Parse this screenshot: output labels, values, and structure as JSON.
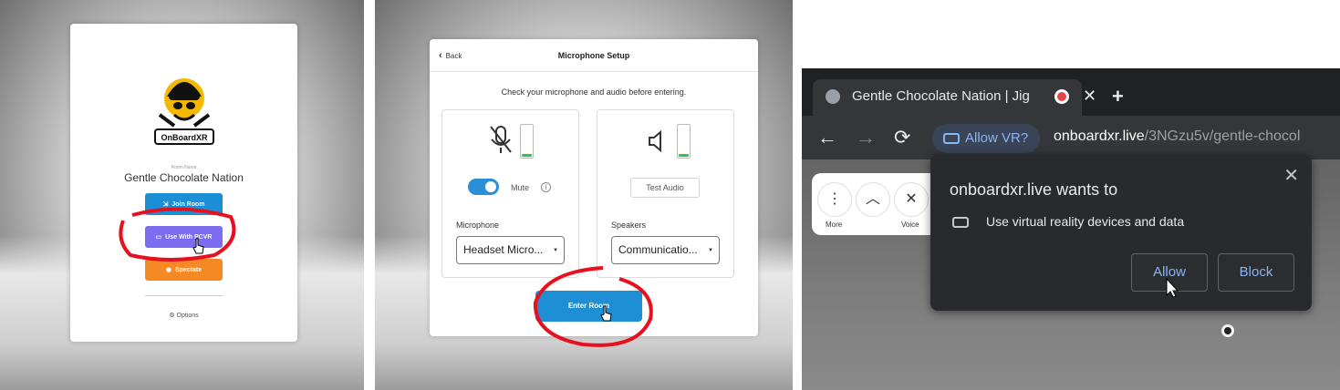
{
  "panel1": {
    "room_caption": "Room Name",
    "room_name": "Gentle Chocolate Nation",
    "logo_text": "OnBoardXR",
    "buttons": {
      "join": "Join Room",
      "pcvr": "Use With PCVR",
      "spectate": "Spectate"
    },
    "options": "Options",
    "colors": {
      "join": "#1a8fd6",
      "pcvr": "#7b6cf0",
      "spectate": "#f58a24",
      "annotation": "#e8101e"
    }
  },
  "panel2": {
    "back": "Back",
    "title": "Microphone Setup",
    "hint": "Check your microphone and audio before entering.",
    "mute_label": "Mute",
    "mute_on": true,
    "test_audio": "Test Audio",
    "mic_label": "Microphone",
    "mic_value": "Headset Micro...",
    "speakers_label": "Speakers",
    "speakers_value": "Communicatio...",
    "enter_room": "Enter Room"
  },
  "panel3": {
    "tab_title": "Gentle Chocolate Nation | Jig",
    "chip_label": "Allow VR?",
    "url_host": "onboardxr.live",
    "url_path": "/3NGzu5v/gentle-chocol",
    "vr_menu": {
      "more": "More",
      "voice": "Voice"
    },
    "prompt_title": "onboardxr.live wants to",
    "prompt_desc": "Use virtual reality devices and data",
    "allow": "Allow",
    "block": "Block",
    "icons": {
      "back": "←",
      "forward": "→",
      "reload": "⟳",
      "close": "✕",
      "new_tab": "+"
    }
  }
}
